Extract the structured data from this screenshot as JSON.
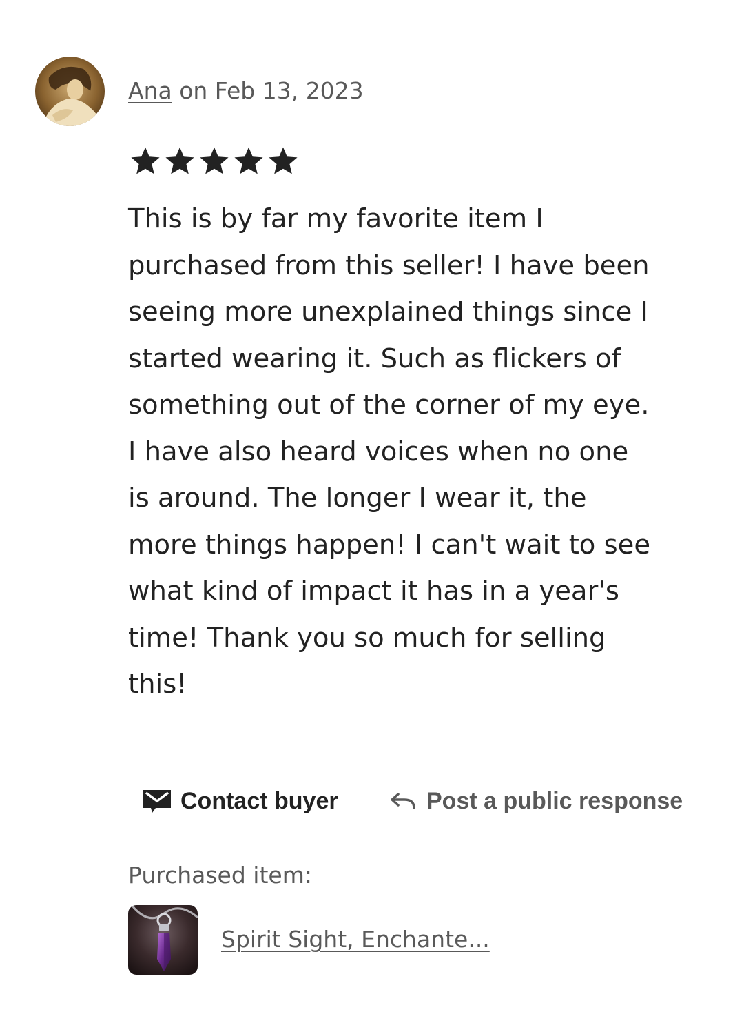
{
  "review": {
    "reviewer_name": "Ana",
    "date_text": " on Feb 13, 2023",
    "rating": 5,
    "rating_max": 5,
    "text": "This is by far my favorite item I\npurchased from this seller! I have been\nseeing more unexplained things since I\nstarted wearing it. Such as flickers of\nsomething out of the corner of my eye.\nI have also heard voices when no one\nis around. The longer I wear it, the\nmore things happen! I can't wait to see\nwhat kind of impact it has in a year's\ntime! Thank you so much for selling\nthis!"
  },
  "actions": {
    "contact_label": "Contact buyer",
    "contact_icon": "envelope-icon",
    "respond_label": "Post a public response",
    "respond_icon": "reply-arrow-icon"
  },
  "purchased": {
    "label": "Purchased item:",
    "item_title": "Spirit Sight, Enchante..."
  },
  "colors": {
    "text_primary": "#222222",
    "text_secondary": "#595959",
    "star": "#222222",
    "background": "#ffffff"
  }
}
